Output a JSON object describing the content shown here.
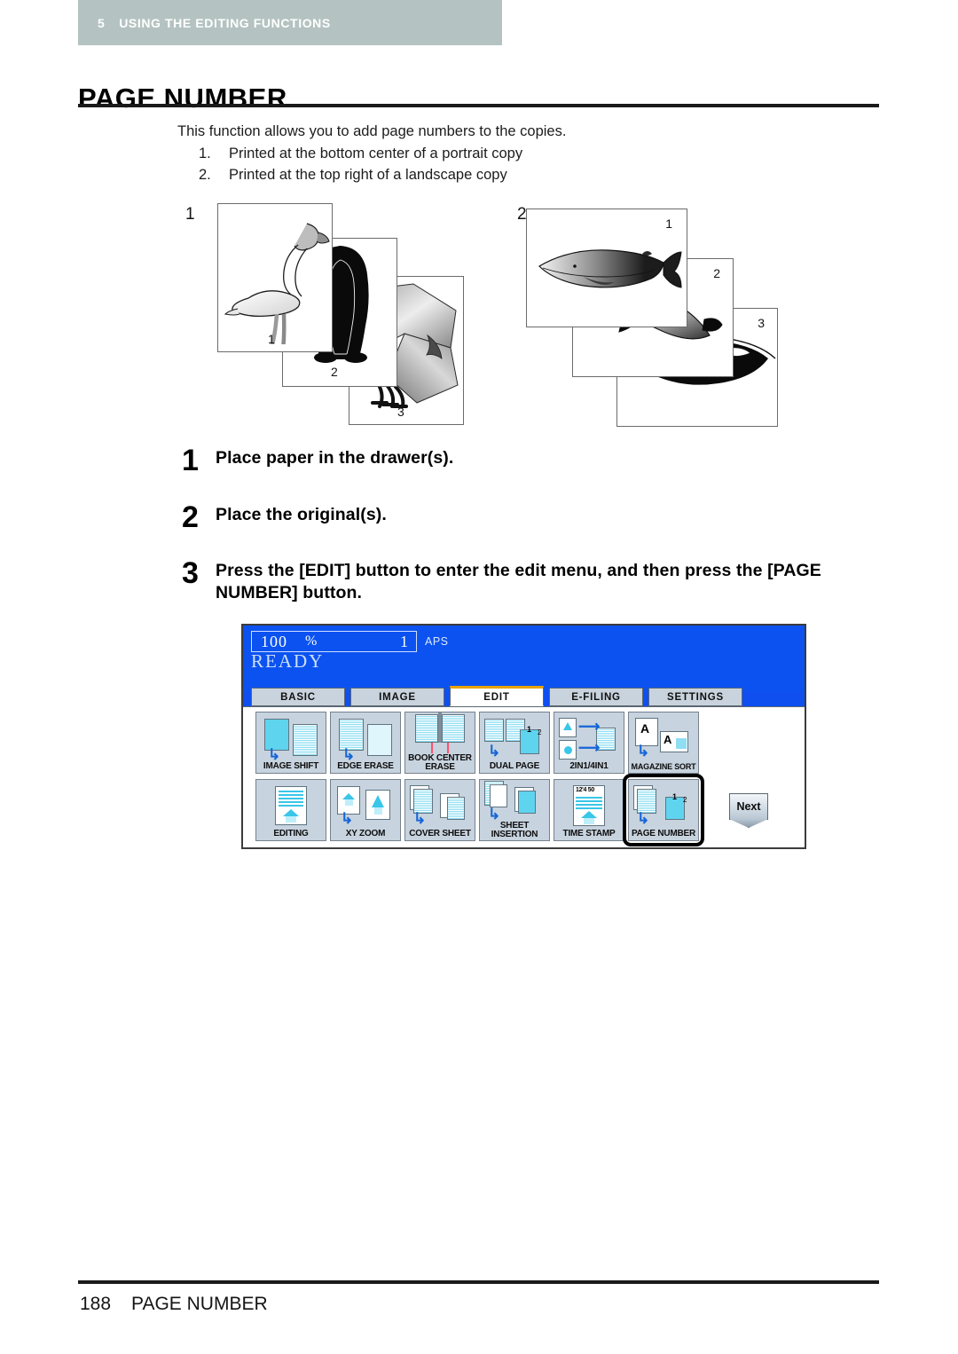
{
  "header": {
    "chapter_number": "5",
    "chapter_title": "USING THE EDITING FUNCTIONS"
  },
  "page_title": "PAGE NUMBER",
  "intro": {
    "lead": "This function allows you to add page numbers to the copies.",
    "items": [
      {
        "num": "1.",
        "text": "Printed at the bottom center of a portrait copy"
      },
      {
        "num": "2.",
        "text": "Printed at the top right of a landscape copy"
      }
    ]
  },
  "illustrations": {
    "group_one": {
      "label": "1",
      "sheets": [
        {
          "page": "1",
          "art": "flamingo"
        },
        {
          "page": "2",
          "art": "penguin"
        },
        {
          "page": "3",
          "art": "bird-closeup"
        }
      ]
    },
    "group_two": {
      "label": "2",
      "sheets": [
        {
          "page": "1",
          "art": "blue-whale"
        },
        {
          "page": "2",
          "art": "dolphin"
        },
        {
          "page": "3",
          "art": "orca"
        }
      ]
    }
  },
  "steps": [
    {
      "num": "1",
      "text": "Place paper in the drawer(s)."
    },
    {
      "num": "2",
      "text": "Place the original(s)."
    },
    {
      "num": "3",
      "text": "Press the [EDIT] button to enter the edit menu, and then press the [PAGE NUMBER] button."
    }
  ],
  "lcd": {
    "ratio": "100",
    "percent": "%",
    "copies": "1",
    "paper_mode": "APS",
    "status": "READY",
    "accent_color": "#e8a300",
    "screen_color": "#0b52f0",
    "tabs": [
      {
        "label": "BASIC",
        "active": false
      },
      {
        "label": "IMAGE",
        "active": false
      },
      {
        "label": "EDIT",
        "active": true
      },
      {
        "label": "E-FILING",
        "active": false
      },
      {
        "label": "SETTINGS",
        "active": false
      }
    ],
    "functions_row1": [
      {
        "label": "IMAGE SHIFT",
        "icon": "image-shift-icon",
        "selected": false
      },
      {
        "label": "EDGE ERASE",
        "icon": "edge-erase-icon",
        "selected": false
      },
      {
        "label": "BOOK CENTER ERASE",
        "icon": "book-center-erase-icon",
        "selected": false
      },
      {
        "label": "DUAL  PAGE",
        "icon": "dual-page-icon",
        "selected": false
      },
      {
        "label": "2IN1/4IN1",
        "icon": "2in1-4in1-icon",
        "selected": false
      },
      {
        "label": "MAGAZINE SORT",
        "icon": "magazine-sort-icon",
        "selected": false
      }
    ],
    "functions_row2": [
      {
        "label": "EDITING",
        "icon": "editing-icon",
        "selected": false
      },
      {
        "label": "XY ZOOM",
        "icon": "xy-zoom-icon",
        "selected": false
      },
      {
        "label": "COVER SHEET",
        "icon": "cover-sheet-icon",
        "selected": false
      },
      {
        "label": "SHEET INSERTION",
        "icon": "sheet-insertion-icon",
        "selected": false
      },
      {
        "label": "TIME STAMP",
        "icon": "time-stamp-icon",
        "selected": false
      },
      {
        "label": "PAGE NUMBER",
        "icon": "page-number-icon",
        "selected": true
      }
    ],
    "next_label": "Next",
    "time_stamp_sample": "12'4  50",
    "dual_page_badges": [
      "1",
      "2"
    ],
    "page_number_badges": [
      "1",
      "2"
    ],
    "magazine_sort_letters": [
      "A",
      "A"
    ]
  },
  "footer": {
    "page_number": "188",
    "section": "PAGE NUMBER"
  }
}
